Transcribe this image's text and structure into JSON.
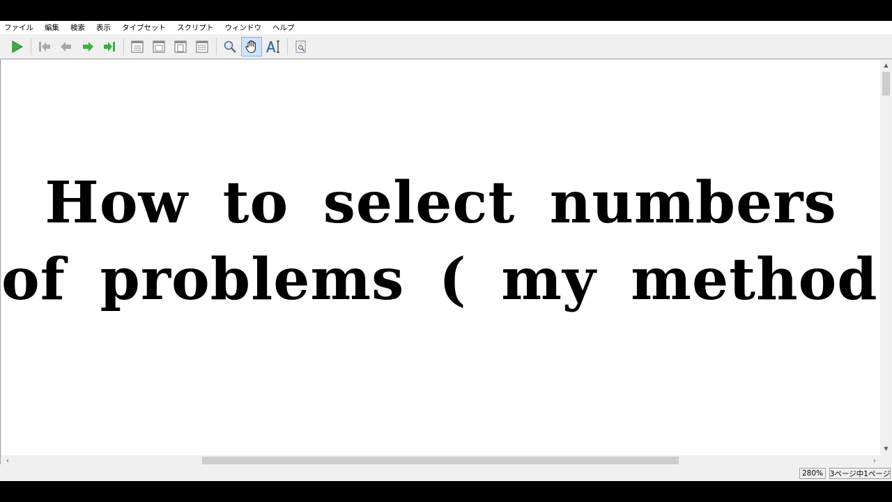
{
  "menu": [
    "ファイル",
    "編集",
    "検索",
    "表示",
    "タイプセット",
    "スクリプト",
    "ウィンドウ",
    "ヘルプ"
  ],
  "toolbar": {
    "buttons": [
      {
        "name": "typeset-play-icon",
        "color": "#3cb043"
      },
      {
        "name": "first-page-icon",
        "color": "#a0a0a0"
      },
      {
        "name": "previous-page-icon",
        "color": "#a0a0a0"
      },
      {
        "name": "next-page-icon",
        "color": "#3cb043"
      },
      {
        "name": "last-page-icon",
        "color": "#3cb043"
      },
      {
        "name": "actual-size-icon"
      },
      {
        "name": "fit-width-icon"
      },
      {
        "name": "fit-window-icon"
      },
      {
        "name": "fit-content-icon"
      },
      {
        "name": "magnify-icon"
      },
      {
        "name": "hand-scroll-icon",
        "active": true
      },
      {
        "name": "text-select-icon"
      },
      {
        "name": "find-in-source-icon"
      }
    ]
  },
  "document": {
    "line1": "How to select numbers",
    "line2": "of problems ( my method )"
  },
  "status": {
    "zoom": "280%",
    "page_info": "3ページ中1ページ"
  }
}
